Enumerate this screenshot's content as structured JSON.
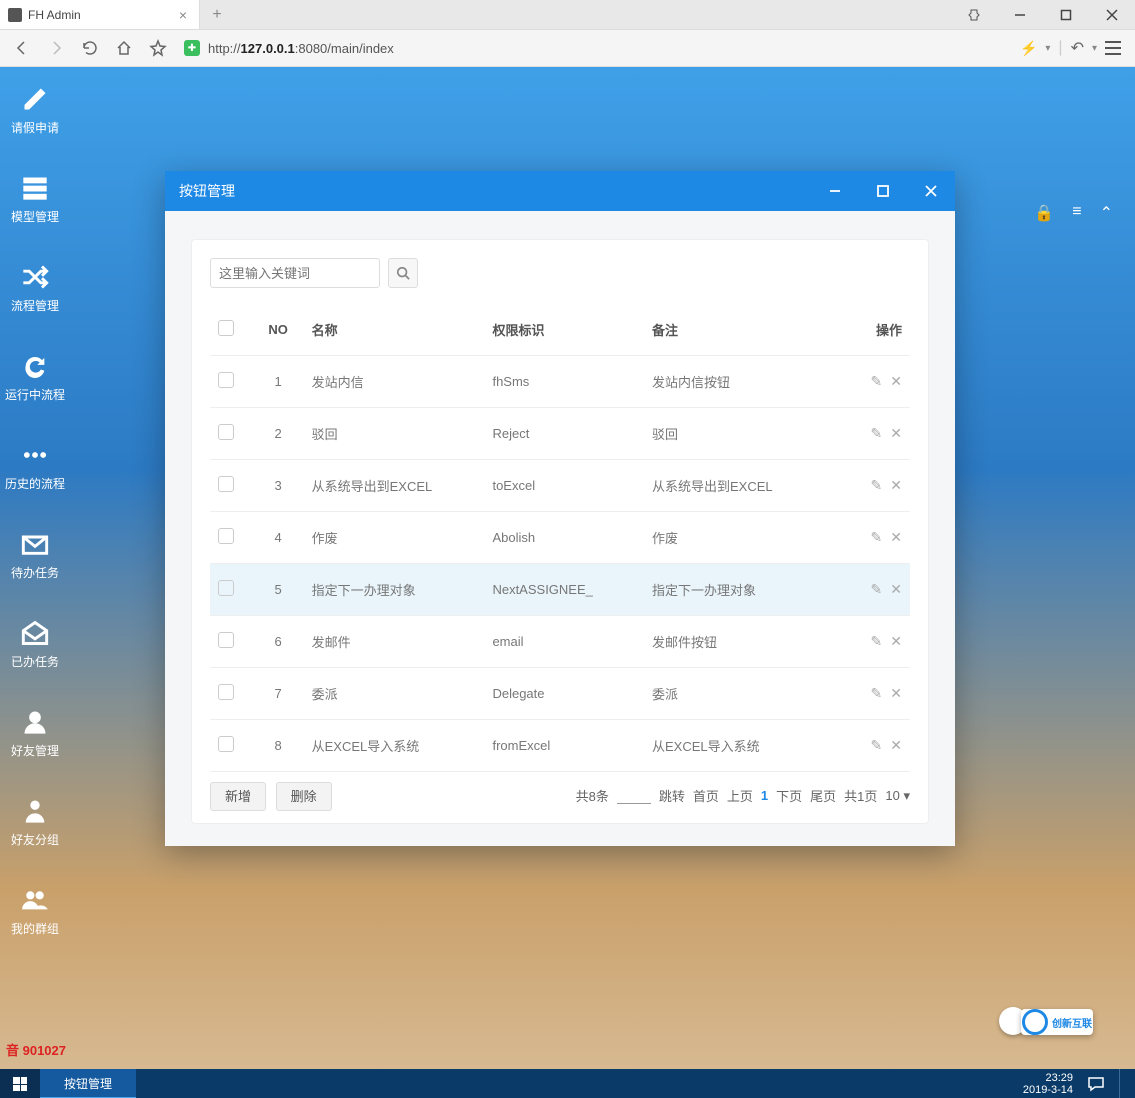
{
  "browser": {
    "tab_title": "FH Admin",
    "url_prefix": "http://",
    "url_host": "127.0.0.1",
    "url_port": ":8080",
    "url_path": "/main/index"
  },
  "sidebar": {
    "items": [
      {
        "label": "请假申请"
      },
      {
        "label": "模型管理"
      },
      {
        "label": "流程管理"
      },
      {
        "label": "运行中流程"
      },
      {
        "label": "历史的流程"
      },
      {
        "label": "待办任务"
      },
      {
        "label": "已办任务"
      },
      {
        "label": "好友管理"
      },
      {
        "label": "好友分组"
      },
      {
        "label": "我的群组"
      }
    ],
    "credit": "音 901027"
  },
  "modal": {
    "title": "按钮管理",
    "search_placeholder": "这里输入关键词",
    "columns": {
      "no": "NO",
      "name": "名称",
      "perm": "权限标识",
      "remark": "备注",
      "op": "操作"
    },
    "rows": [
      {
        "no": "1",
        "name": "发站内信",
        "perm": "fhSms",
        "remark": "发站内信按钮"
      },
      {
        "no": "2",
        "name": "驳回",
        "perm": "Reject",
        "remark": "驳回"
      },
      {
        "no": "3",
        "name": "从系统导出到EXCEL",
        "perm": "toExcel",
        "remark": "从系统导出到EXCEL"
      },
      {
        "no": "4",
        "name": "作废",
        "perm": "Abolish",
        "remark": "作废"
      },
      {
        "no": "5",
        "name": "指定下一办理对象",
        "perm": "NextASSIGNEE_",
        "remark": "指定下一办理对象"
      },
      {
        "no": "6",
        "name": "发邮件",
        "perm": "email",
        "remark": "发邮件按钮"
      },
      {
        "no": "7",
        "name": "委派",
        "perm": "Delegate",
        "remark": "委派"
      },
      {
        "no": "8",
        "name": "从EXCEL导入系统",
        "perm": "fromExcel",
        "remark": "从EXCEL导入系统"
      }
    ],
    "btn_new": "新增",
    "btn_del": "删除",
    "pager": {
      "total": "共8条",
      "jump": "跳转",
      "first": "首页",
      "prev": "上页",
      "cur": "1",
      "next": "下页",
      "last": "尾页",
      "pages": "共1页",
      "size": "10 ▾"
    }
  },
  "taskbar": {
    "label": "按钮管理",
    "time": "23:29",
    "date": "2019-3-14"
  },
  "logo": "创新互联"
}
